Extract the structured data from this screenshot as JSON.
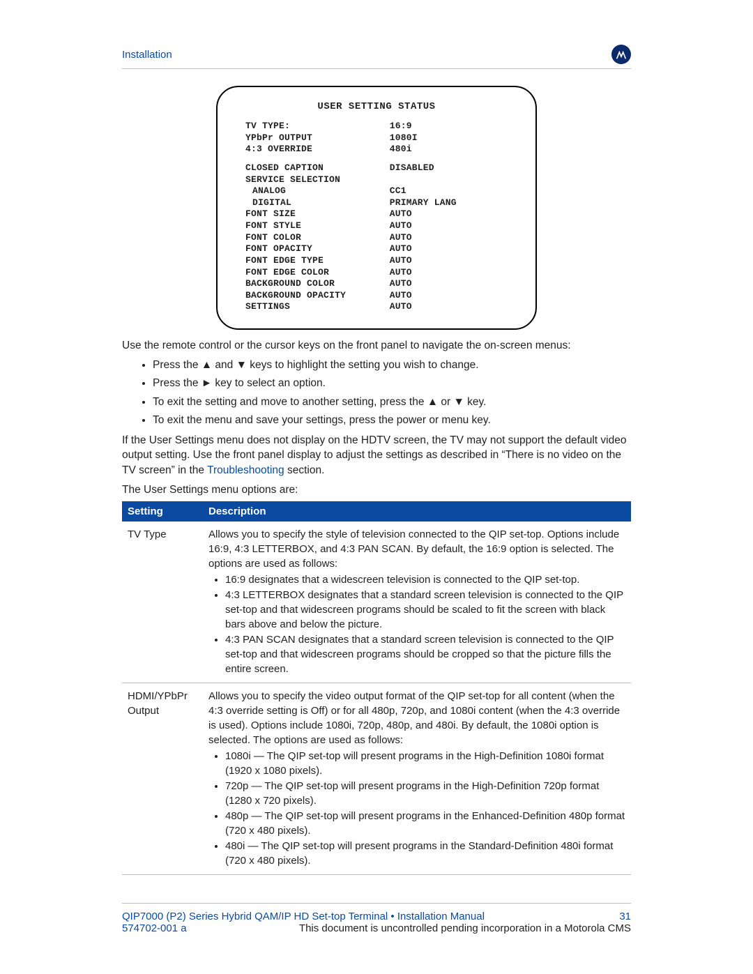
{
  "header": {
    "section": "Installation"
  },
  "screen": {
    "title": "USER SETTING STATUS",
    "rows_block1": [
      {
        "label": "TV TYPE:",
        "value": "16:9"
      },
      {
        "label": "YPbPr OUTPUT",
        "value": "1080I"
      },
      {
        "label": "4:3 OVERRIDE",
        "value": "480i"
      }
    ],
    "rows_block2": [
      {
        "label": "CLOSED CAPTION",
        "value": "DISABLED"
      },
      {
        "label": "SERVICE SELECTION",
        "value": ""
      },
      {
        "label": "ANALOG",
        "value": "CC1",
        "indent": true
      },
      {
        "label": "DIGITAL",
        "value": "PRIMARY LANG",
        "indent": true
      },
      {
        "label": "FONT SIZE",
        "value": "AUTO"
      },
      {
        "label": "FONT STYLE",
        "value": "AUTO"
      },
      {
        "label": "FONT COLOR",
        "value": "AUTO"
      },
      {
        "label": "FONT OPACITY",
        "value": "AUTO"
      },
      {
        "label": "FONT EDGE TYPE",
        "value": "AUTO"
      },
      {
        "label": "FONT EDGE COLOR",
        "value": "AUTO"
      },
      {
        "label": "BACKGROUND COLOR",
        "value": "AUTO"
      },
      {
        "label": "BACKGROUND OPACITY",
        "value": "AUTO"
      },
      {
        "label": "SETTINGS",
        "value": "AUTO"
      }
    ]
  },
  "body": {
    "intro": "Use the remote control or the cursor keys on the front panel to navigate the on-screen menus:",
    "bullets": [
      "Press the ▲ and ▼ keys to highlight the setting you wish to change.",
      "Press the ► key to select an option.",
      "To exit the setting and move to another setting, press the ▲ or ▼ key.",
      "To exit the menu and save your settings, press the power or menu key."
    ],
    "note_pre": "If the User Settings menu does not display on the HDTV screen, the TV may not support the default video output setting. Use the front panel display to adjust the settings as described in “There is no video on the TV screen” in the ",
    "note_link": "Troubleshooting",
    "note_post": " section.",
    "options_lead": "The User Settings menu options are:"
  },
  "table": {
    "head_setting": "Setting",
    "head_description": "Description",
    "rows": [
      {
        "setting": "TV Type",
        "desc_intro": "Allows you to specify the style of television connected to the QIP set-top. Options include 16:9, 4:3 LETTERBOX, and 4:3 PAN SCAN. By default, the 16:9 option is selected. The options are used as follows:",
        "items": [
          "16:9 designates that a widescreen television is connected to the QIP set-top.",
          "4:3 LETTERBOX designates that a standard screen television is connected to the QIP set-top and that widescreen programs should be scaled to fit the screen with black bars above and below the picture.",
          "4:3 PAN SCAN designates that a standard screen television is connected to the QIP set-top and that widescreen programs should be cropped so that the picture fills the entire screen."
        ]
      },
      {
        "setting": "HDMI/YPbPr Output",
        "desc_intro": "Allows you to specify the video output format of the QIP set-top for all content (when the 4:3 override setting is Off) or for all 480p, 720p, and 1080i content (when the 4:3 override is used). Options include 1080i, 720p, 480p, and 480i. By default, the 1080i option is selected. The options are used as follows:",
        "items": [
          "1080i — The QIP set-top will present programs in the High-Definition 1080i format (1920 x 1080 pixels).",
          "720p — The QIP set-top will present programs in the High-Definition 720p format (1280 x 720 pixels).",
          "480p — The QIP set-top will present programs in the Enhanced-Definition 480p format (720 x 480 pixels).",
          "480i — The QIP set-top will present programs in the Standard-Definition 480i format (720 x 480 pixels)."
        ]
      }
    ]
  },
  "footer": {
    "doc_title": "QIP7000 (P2) Series Hybrid QAM/IP HD Set-top Terminal • Installation Manual",
    "page_no": "31",
    "doc_no": "574702-001 a",
    "disclaimer": "This document is uncontrolled pending incorporation in a Motorola CMS"
  }
}
